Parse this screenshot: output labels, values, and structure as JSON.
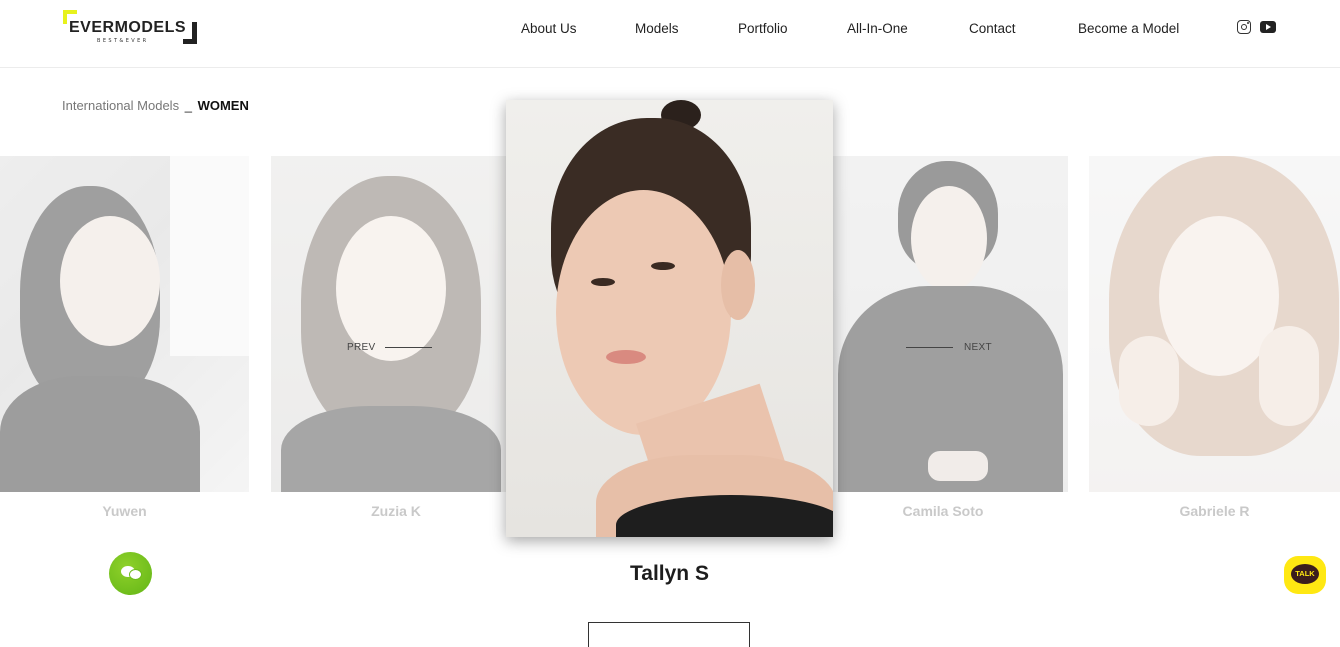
{
  "brand": {
    "name": "EVERMODELS",
    "tagline": "BEST&EVER"
  },
  "nav": {
    "items": [
      {
        "label": "About Us"
      },
      {
        "label": "Models"
      },
      {
        "label": "Portfolio"
      },
      {
        "label": "All-In-One"
      },
      {
        "label": "Contact"
      },
      {
        "label": "Become a Model"
      }
    ],
    "social": [
      "instagram-icon",
      "youtube-icon"
    ]
  },
  "breadcrumb": {
    "parent": "International Models",
    "separator": "_",
    "current": "WOMEN"
  },
  "carousel": {
    "prev_label": "PREV",
    "next_label": "NEXT",
    "models": [
      {
        "name": "Yuwen"
      },
      {
        "name": "Zuzia K"
      },
      {
        "name": "Tallyn S"
      },
      {
        "name": "Camila Soto"
      },
      {
        "name": "Gabriele R"
      }
    ],
    "active_index": 2
  },
  "floating": {
    "talk_label": "TALK"
  },
  "colors": {
    "brand_yellow": "#e7f21c",
    "chat_green": "#6cbb1c",
    "kakao_yellow": "#ffe812"
  }
}
